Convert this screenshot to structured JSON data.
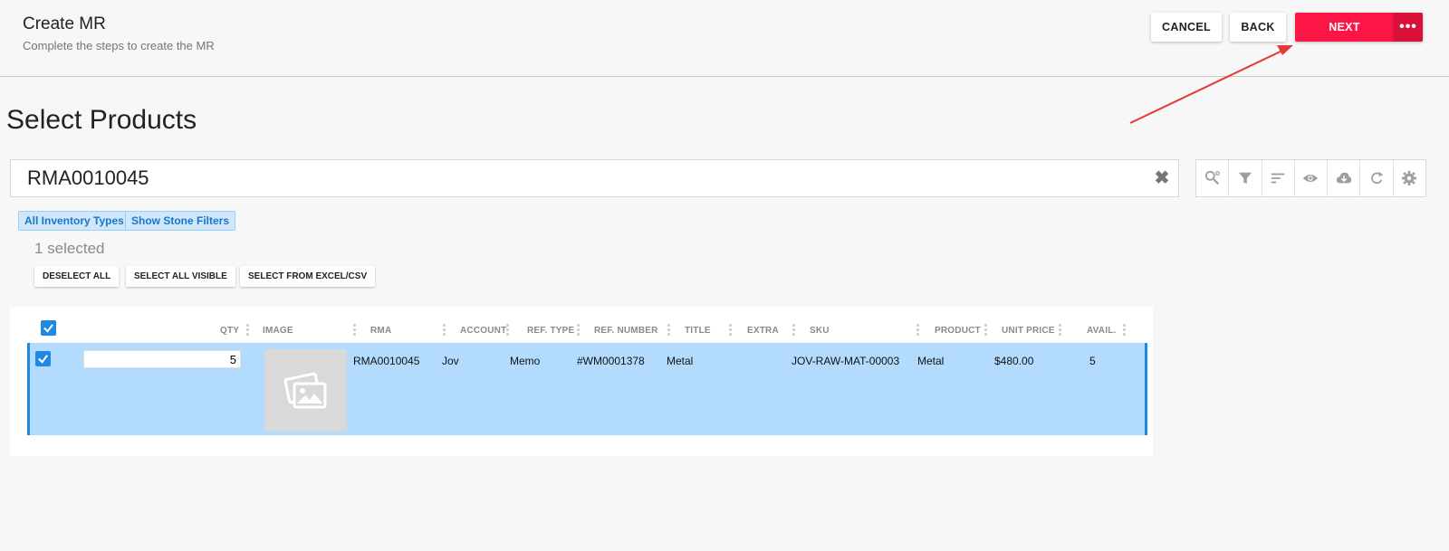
{
  "header": {
    "title": "Create MR",
    "subtitle": "Complete the steps to create the MR",
    "cancel_label": "CANCEL",
    "back_label": "BACK",
    "next_label": "NEXT",
    "more_label": "•••"
  },
  "page": {
    "title": "Select Products"
  },
  "search": {
    "value": "RMA0010045",
    "clear_glyph": "✖"
  },
  "toolbar": {
    "icons": [
      "advanced-search-icon",
      "filter-icon",
      "sort-icon",
      "eye-icon",
      "cloud-download-icon",
      "refresh-icon",
      "gear-icon"
    ]
  },
  "filters": {
    "inventory_types": "All Inventory Types",
    "stone_filters": "Show Stone Filters"
  },
  "selection": {
    "count_text": "1 selected",
    "deselect_all": "DESELECT ALL",
    "select_all_visible": "SELECT ALL VISIBLE",
    "select_from_excel": "SELECT FROM EXCEL/CSV"
  },
  "table": {
    "columns": {
      "qty": "QTY",
      "image": "IMAGE",
      "rma": "RMA",
      "account": "ACCOUNT",
      "ref_type": "REF. TYPE",
      "ref_number": "REF. NUMBER",
      "title": "TITLE",
      "extra": "EXTRA",
      "sku": "SKU",
      "product": "PRODUCT",
      "unit_price": "UNIT PRICE",
      "avail": "AVAIL."
    },
    "rows": [
      {
        "selected": true,
        "qty": "5",
        "rma": "RMA0010045",
        "account": "Jov",
        "ref_type": "Memo",
        "ref_number": "#WM0001378",
        "title": "Metal",
        "extra": "",
        "sku": "JOV-RAW-MAT-00003",
        "product": "Metal",
        "unit_price": "$480.00",
        "avail": "5"
      }
    ]
  },
  "colors": {
    "accent": "#fb1645",
    "accent_dark": "#d8103a",
    "selection": "#b3dbfd",
    "checkbox": "#1e88e5",
    "annotation_arrow": "#e53935"
  }
}
